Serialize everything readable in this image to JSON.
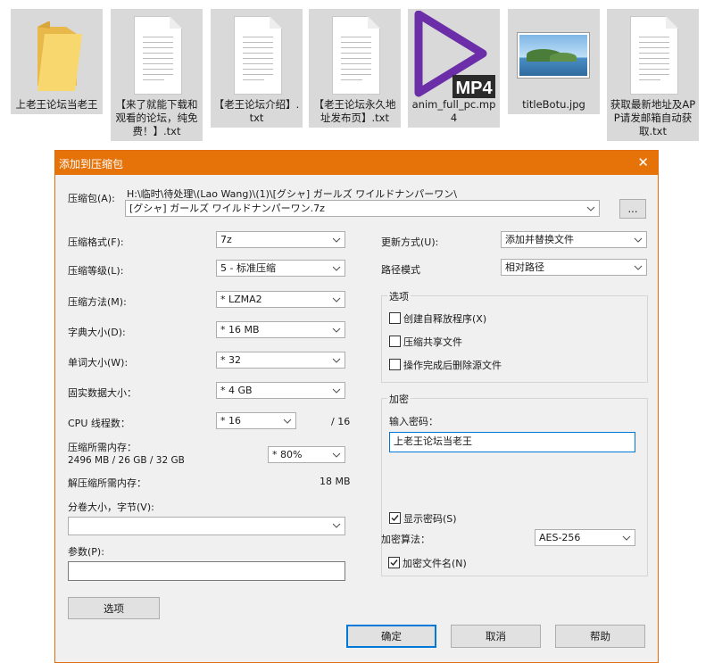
{
  "desktop": {
    "files": [
      {
        "name": "上老王论坛当老王",
        "icon": "folder-icon"
      },
      {
        "name": "【来了就能下载和观看的论坛，纯免费！】.txt",
        "icon": "text-file-icon"
      },
      {
        "name": "【老王论坛介绍】.txt",
        "icon": "text-file-icon"
      },
      {
        "name": "【老王论坛永久地址发布页】.txt",
        "icon": "text-file-icon"
      },
      {
        "name": "anim_full_pc.mp4",
        "icon": "mp4-video-icon",
        "badge": "MP4"
      },
      {
        "name": "titleBotu.jpg",
        "icon": "image-thumbnail-icon"
      },
      {
        "name": "获取最新地址及APP请发邮箱自动获取.txt",
        "icon": "text-file-icon"
      }
    ]
  },
  "dialog": {
    "title": "添加到压缩包",
    "close_glyph": "✕",
    "archive": {
      "label": "压缩包(A):",
      "path_line": "H:\\临时\\待处理\\(Lao Wang)\\(1)\\[グシャ] ガールズ ワイルドナンパーワン\\",
      "name_value": "[グシャ] ガールズ ワイルドナンパーワン.7z",
      "browse_label": "..."
    },
    "left": {
      "format": {
        "label": "压缩格式(F):",
        "value": "7z"
      },
      "level": {
        "label": "压缩等级(L):",
        "value": "5 - 标准压缩"
      },
      "method": {
        "label": "压缩方法(M):",
        "value": "* LZMA2"
      },
      "dict": {
        "label": "字典大小(D):",
        "value": "* 16 MB"
      },
      "word": {
        "label": "单词大小(W):",
        "value": "* 32"
      },
      "solid": {
        "label": "固实数据大小：",
        "value": "* 4 GB"
      },
      "cpu": {
        "label": "CPU 线程数：",
        "value": "* 16",
        "total": "/ 16"
      },
      "mem_comp": {
        "label": "压缩所需内存：",
        "detail": "2496 MB / 26 GB / 32 GB",
        "value": "* 80%"
      },
      "mem_decomp": {
        "label": "解压缩所需内存：",
        "value": "18 MB"
      },
      "volume": {
        "label": "分卷大小，字节(V):",
        "value": ""
      },
      "params": {
        "label": "参数(P):",
        "value": ""
      },
      "options_button": "选项"
    },
    "right": {
      "update": {
        "label": "更新方式(U):",
        "value": "添加并替换文件"
      },
      "path_mode": {
        "label": "路径模式",
        "value": "相对路径"
      },
      "options_group": {
        "title": "选项",
        "sfx": {
          "label": "创建自释放程序(X)",
          "checked": false
        },
        "shared": {
          "label": "压缩共享文件",
          "checked": false
        },
        "delete_after": {
          "label": "操作完成后删除源文件",
          "checked": false
        }
      },
      "encryption": {
        "title": "加密",
        "password_label": "输入密码：",
        "password_value": "上老王论坛当老王",
        "show_password": {
          "label": "显示密码(S)",
          "checked": true
        },
        "method_label": "加密算法：",
        "method_value": "AES-256",
        "encrypt_names": {
          "label": "加密文件名(N)",
          "checked": true
        }
      }
    },
    "buttons": {
      "ok": "确定",
      "cancel": "取消",
      "help": "帮助"
    },
    "colors": {
      "titlebar": "#e6720a",
      "focus": "#0078d7",
      "background": "#f0f0f0"
    }
  }
}
